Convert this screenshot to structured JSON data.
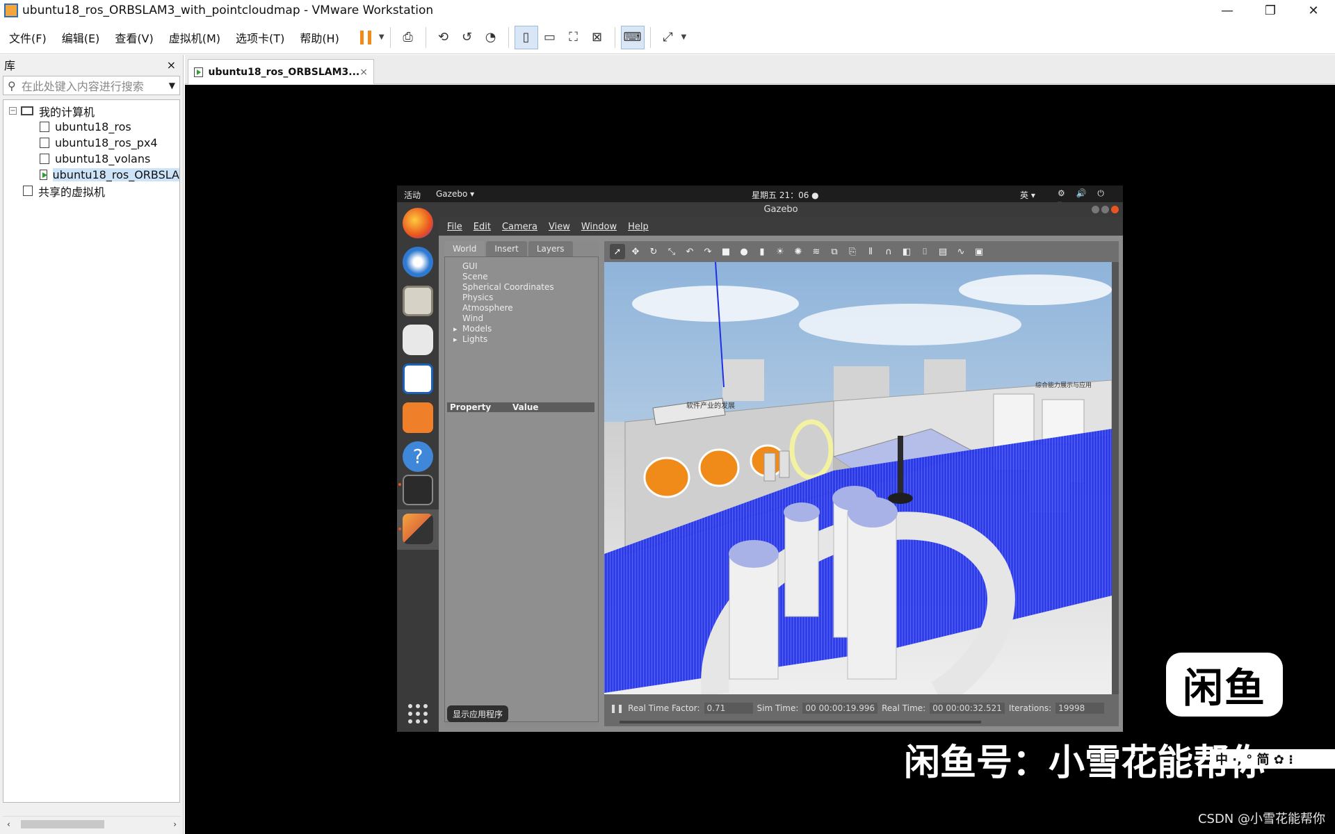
{
  "window": {
    "title": "ubuntu18_ros_ORBSLAM3_with_pointcloudmap - VMware Workstation",
    "controls": {
      "minimize": "—",
      "restore": "❐",
      "close": "✕"
    }
  },
  "menu": [
    "文件(F)",
    "编辑(E)",
    "查看(V)",
    "虚拟机(M)",
    "选项卡(T)",
    "帮助(H)"
  ],
  "library": {
    "title": "库",
    "close": "×",
    "search_placeholder": "在此处键入内容进行搜索",
    "root_label": "我的计算机",
    "vms": [
      "ubuntu18_ros",
      "ubuntu18_ros_px4",
      "ubuntu18_volans",
      "ubuntu18_ros_ORBSLA"
    ],
    "shared_label": "共享的虚拟机"
  },
  "vm_tab": {
    "label": "ubuntu18_ros_ORBSLAM3...",
    "close": "×"
  },
  "ubuntu": {
    "activities": "活动",
    "app_menu": "Gazebo ▾",
    "clock": "星期五 21：06 ●",
    "ime": "英 ▾",
    "sys_icons": "⚙ 🔊 ⏻ ▾"
  },
  "gazebo": {
    "title": "Gazebo",
    "menu": [
      "File",
      "Edit",
      "Camera",
      "View",
      "Window",
      "Help"
    ],
    "tabs": [
      "World",
      "Insert",
      "Layers"
    ],
    "world_tree": [
      "GUI",
      "Scene",
      "Spherical Coordinates",
      "Physics",
      "Atmosphere",
      "Wind",
      "Models",
      "Lights"
    ],
    "prop_header": {
      "property": "Property",
      "value": "Value"
    },
    "show_apps": "显示应用程序",
    "status": {
      "real_time_factor_label": "Real Time Factor:",
      "real_time_factor": "0.71",
      "sim_time_label": "Sim Time:",
      "sim_time": "00 00:00:19.996",
      "real_time_label": "Real Time:",
      "real_time": "00 00:00:32.521",
      "iterations_label": "Iterations:",
      "iterations": "19998"
    },
    "scene_signs": [
      "软件产业的发展",
      "综合能力展示与应用"
    ]
  },
  "overlay": {
    "logo": "闲鱼",
    "watermark": "闲鱼号：小雪花能帮你",
    "ime_bar": "中 ·, ° 简 ✿ ⁝",
    "csdn": "CSDN @小雪花能帮你"
  },
  "colors": {
    "ubuntu_orange": "#e95420",
    "pointcloud_blue": "#1f2fe6",
    "vmware_pause": "#f08a18"
  }
}
